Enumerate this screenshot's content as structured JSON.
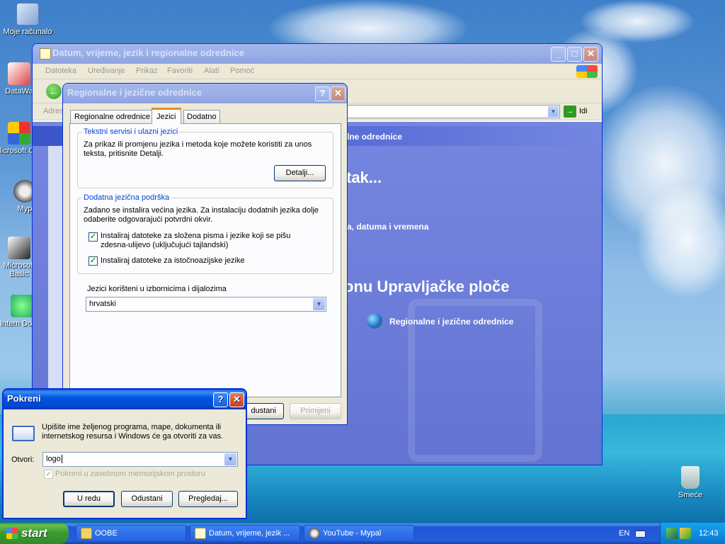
{
  "desktop": {
    "icons": [
      {
        "label": "Moje računalo"
      },
      {
        "label": "DataWa"
      },
      {
        "label": "Microsoft C++"
      },
      {
        "label": "Myp"
      },
      {
        "label": "Microsoft Basic"
      },
      {
        "label": "Intern Downl"
      },
      {
        "label": "Smeće"
      }
    ]
  },
  "control_panel": {
    "title": "Datum, vrijeme, jezik i regionalne odrednice",
    "menu": [
      "Datoteka",
      "Uređivanje",
      "Prikaz",
      "Favoriti",
      "Alati",
      "Pomoć"
    ],
    "address_label": "Adres",
    "go_label": "Idi",
    "header_partial": "lne odrednice",
    "pick_task_partial": "tak...",
    "task_partial": "a, datuma i vremena",
    "pick_icon_partial": "onu Upravljačke ploče",
    "icon_link": "Regionalne i jezične odrednice"
  },
  "regional_dialog": {
    "title": "Regionalne i jezične odrednice",
    "tabs": [
      "Regionalne odrednice",
      "Jezici",
      "Dodatno"
    ],
    "active_tab": "Jezici",
    "group1": {
      "legend": "Tekstni servisi i ulazni jezici",
      "text": "Za prikaz ili promjenu jezika i metoda koje možete koristiti za unos teksta, pritisnite Detalji.",
      "button": "Detalji..."
    },
    "group2": {
      "legend": "Dodatna jezična podrška",
      "text": "Zadano se instalira većina jezika. Za instalaciju dodatnih jezika dolje odaberite odgovarajući potvrdni okvir.",
      "check1": "Instaliraj datoteke za složena pisma i jezike koji se pišu zdesna-ulijevo (uključujući tajlandski)",
      "check1_checked": true,
      "check2": "Instaliraj datoteke za istočnoazijske jezike",
      "check2_checked": true
    },
    "menu_lang_label": "Jezici korišteni u izbornicima i dijalozima",
    "menu_lang_value": "hrvatski",
    "cancel_partial": "dustani",
    "apply": "Primijeni"
  },
  "run_dialog": {
    "title": "Pokreni",
    "description": "Upišite ime željenog programa, mape, dokumenta ili internetskog resursa i Windows će ga otvoriti za vas.",
    "open_label": "Otvori:",
    "open_value": "logo",
    "separate_memory": "Pokreni u zasebnom memorijskom prostoru",
    "ok": "U redu",
    "cancel": "Odustani",
    "browse": "Pregledaj..."
  },
  "taskbar": {
    "start": "start",
    "items": [
      "OOBE",
      "Datum, vrijeme, jezik ...",
      "YouTube - Mypal"
    ],
    "language": "EN",
    "clock": "12:43"
  }
}
